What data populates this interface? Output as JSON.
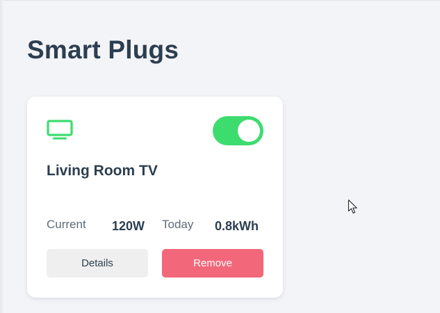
{
  "page": {
    "title": "Smart Plugs"
  },
  "plugs": [
    {
      "icon": "tv-icon",
      "name": "Living Room TV",
      "enabled": true,
      "current_label": "Current",
      "current_value": "120W",
      "today_label": "Today",
      "today_value": "0.8kWh",
      "details_label": "Details",
      "remove_label": "Remove"
    }
  ],
  "colors": {
    "accent_green": "#3ddc6e",
    "danger": "#f2677a",
    "text_dark": "#2c3e50",
    "background": "#f3f4f8"
  }
}
